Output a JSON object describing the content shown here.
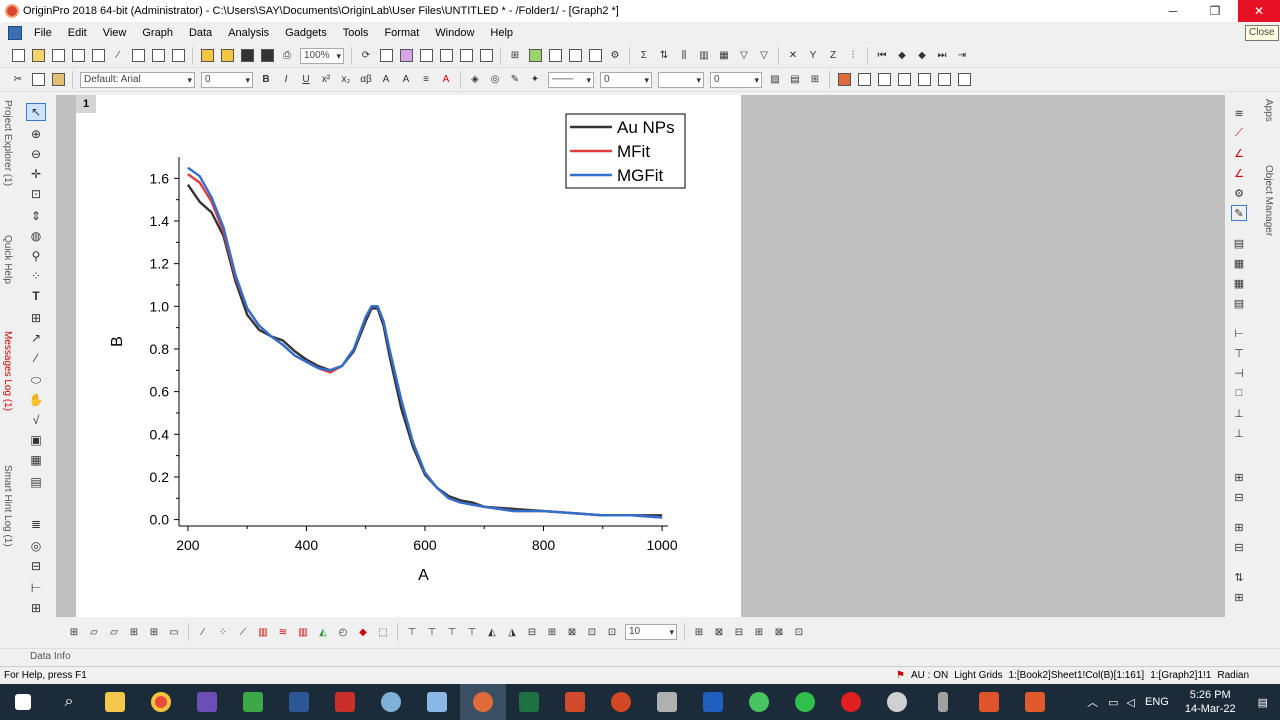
{
  "window": {
    "title": "OriginPro 2018 64-bit (Administrator) - C:\\Users\\SAY\\Documents\\OriginLab\\User Files\\UNTITLED * - /Folder1/ - [Graph2 *]",
    "close_tooltip": "Close"
  },
  "menu": {
    "items": [
      "File",
      "Edit",
      "View",
      "Graph",
      "Data",
      "Analysis",
      "Gadgets",
      "Tools",
      "Format",
      "Window",
      "Help"
    ]
  },
  "toolbar": {
    "zoom": "100%",
    "font": "Default: Arial",
    "font_size": "0",
    "line_width": "0",
    "pattern_value": "0",
    "bottom_size": "10"
  },
  "left_panel": {
    "tabs": [
      "Project Explorer (1)",
      "Quick Help",
      "Messages Log (1)",
      "Smart Hint Log (1)"
    ]
  },
  "right_panel": {
    "tabs": [
      "Apps",
      "Object Manager"
    ]
  },
  "graph": {
    "layer_number": "1"
  },
  "chart_data": {
    "type": "line",
    "xlabel": "A",
    "ylabel": "B",
    "xlim": [
      185,
      1010
    ],
    "ylim": [
      -0.03,
      1.7
    ],
    "xticks": [
      200,
      400,
      600,
      800,
      1000
    ],
    "yticks": [
      0.0,
      0.2,
      0.4,
      0.6,
      0.8,
      1.0,
      1.2,
      1.4,
      1.6
    ],
    "grid": false,
    "legend_position": "top-right",
    "series": [
      {
        "name": "Au NPs",
        "color": "#333333",
        "x": [
          200,
          220,
          240,
          260,
          280,
          300,
          320,
          340,
          360,
          380,
          400,
          420,
          440,
          460,
          480,
          500,
          510,
          520,
          530,
          540,
          560,
          580,
          600,
          620,
          640,
          660,
          680,
          700,
          750,
          800,
          850,
          900,
          950,
          1000
        ],
        "y": [
          1.57,
          1.49,
          1.44,
          1.33,
          1.12,
          0.96,
          0.89,
          0.86,
          0.84,
          0.79,
          0.75,
          0.72,
          0.7,
          0.72,
          0.79,
          0.93,
          0.99,
          0.99,
          0.91,
          0.77,
          0.52,
          0.34,
          0.21,
          0.15,
          0.11,
          0.09,
          0.08,
          0.06,
          0.05,
          0.04,
          0.03,
          0.02,
          0.02,
          0.02
        ]
      },
      {
        "name": "MFit",
        "color": "#e03c3c",
        "x": [
          200,
          220,
          240,
          260,
          280,
          300,
          320,
          340,
          360,
          380,
          400,
          420,
          440,
          460,
          480,
          500,
          510,
          520,
          530,
          540,
          560,
          580,
          600,
          620,
          640,
          660,
          680,
          700,
          750,
          800,
          850,
          900,
          950,
          1000
        ],
        "y": [
          1.62,
          1.58,
          1.49,
          1.35,
          1.14,
          0.99,
          0.91,
          0.86,
          0.82,
          0.77,
          0.74,
          0.71,
          0.69,
          0.72,
          0.8,
          0.95,
          1.0,
          1.0,
          0.93,
          0.8,
          0.56,
          0.36,
          0.22,
          0.15,
          0.1,
          0.08,
          0.07,
          0.06,
          0.04,
          0.04,
          0.03,
          0.02,
          0.02,
          0.01
        ]
      },
      {
        "name": "MGFit",
        "color": "#2f6fcf",
        "x": [
          200,
          220,
          240,
          260,
          280,
          300,
          320,
          340,
          360,
          380,
          400,
          420,
          440,
          460,
          480,
          500,
          510,
          520,
          530,
          540,
          560,
          580,
          600,
          620,
          640,
          660,
          680,
          700,
          750,
          800,
          850,
          900,
          950,
          1000
        ],
        "y": [
          1.65,
          1.61,
          1.51,
          1.37,
          1.15,
          0.99,
          0.91,
          0.86,
          0.82,
          0.77,
          0.74,
          0.71,
          0.7,
          0.72,
          0.8,
          0.95,
          1.0,
          1.0,
          0.93,
          0.8,
          0.56,
          0.36,
          0.22,
          0.15,
          0.1,
          0.08,
          0.07,
          0.06,
          0.04,
          0.04,
          0.03,
          0.02,
          0.02,
          0.01
        ]
      }
    ]
  },
  "status": {
    "help": "For Help, press F1",
    "au": "AU : ON",
    "grids": "Light Grids",
    "book": "1:[Book2]Sheet1!Col(B)[1:161]",
    "graph": "1:[Graph2]1!1",
    "unit": "Radian"
  },
  "data_info_label": "Data Info",
  "taskbar": {
    "time": "5:26 PM",
    "date": "14-Mar-22",
    "lang": "ENG"
  }
}
